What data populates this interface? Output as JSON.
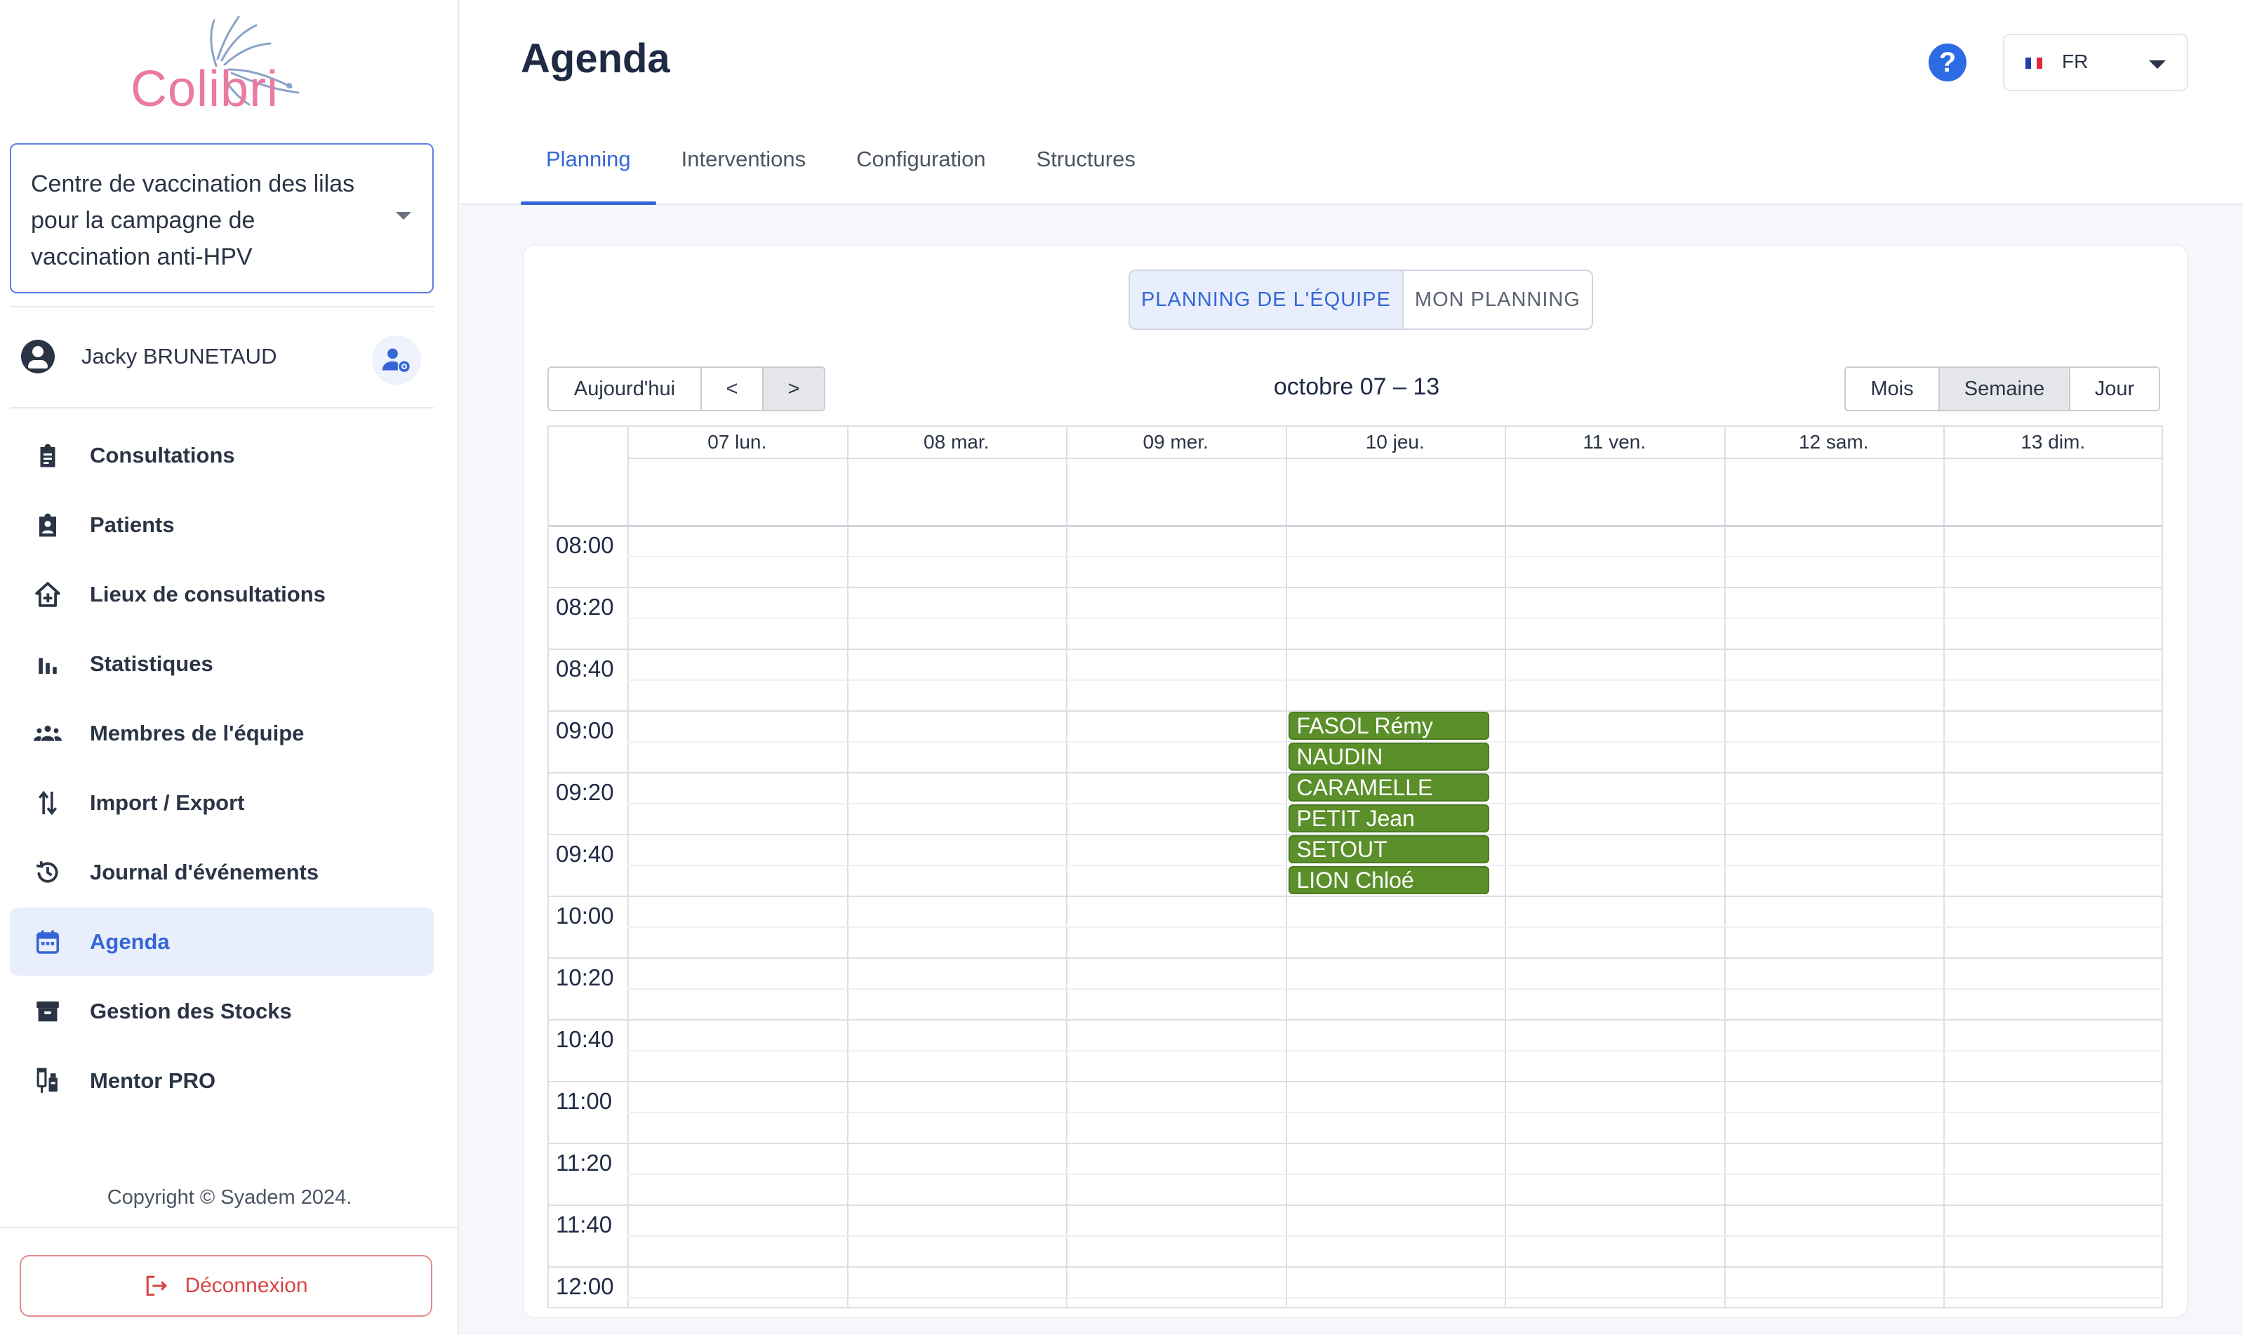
{
  "app": {
    "logo_text": "Colibri"
  },
  "sidebar": {
    "structure": "Centre de vaccination des lilas pour la campagne de vaccination anti-HPV",
    "user_name": "Jacky BRUNETAUD",
    "items": [
      {
        "label": "Consultations",
        "icon": "clipboard-icon",
        "active": false
      },
      {
        "label": "Patients",
        "icon": "patient-badge-icon",
        "active": false
      },
      {
        "label": "Lieux de consultations",
        "icon": "house-plus-icon",
        "active": false
      },
      {
        "label": "Statistiques",
        "icon": "bar-chart-icon",
        "active": false
      },
      {
        "label": "Membres de l'équipe",
        "icon": "team-icon",
        "active": false
      },
      {
        "label": "Import / Export",
        "icon": "import-export-icon",
        "active": false
      },
      {
        "label": "Journal d'événements",
        "icon": "history-icon",
        "active": false
      },
      {
        "label": "Agenda",
        "icon": "calendar-icon",
        "active": true
      },
      {
        "label": "Gestion des Stocks",
        "icon": "archive-box-icon",
        "active": false
      },
      {
        "label": "Mentor PRO",
        "icon": "vaccine-icon",
        "active": false
      }
    ],
    "copyright": "Copyright © Syadem 2024.",
    "logout_label": "Déconnexion"
  },
  "header": {
    "title": "Agenda",
    "help_label": "?",
    "language": "FR",
    "tabs": [
      {
        "label": "Planning",
        "active": true
      },
      {
        "label": "Interventions",
        "active": false
      },
      {
        "label": "Configuration",
        "active": false
      },
      {
        "label": "Structures",
        "active": false
      }
    ]
  },
  "calendar": {
    "view_toggle": {
      "team": "PLANNING DE L'ÉQUIPE",
      "mine": "MON PLANNING"
    },
    "nav": {
      "today": "Aujourd'hui",
      "prev": "<",
      "next": ">"
    },
    "range_title": "octobre 07 – 13",
    "views": {
      "month": "Mois",
      "week": "Semaine",
      "day": "Jour"
    },
    "days": [
      "07 lun.",
      "08 mar.",
      "09 mer.",
      "10 jeu.",
      "11 ven.",
      "12 sam.",
      "13 dim."
    ],
    "times": [
      "08:00",
      "08:20",
      "08:40",
      "09:00",
      "09:20",
      "09:40",
      "10:00",
      "10:20",
      "10:40",
      "11:00",
      "11:20",
      "11:40",
      "12:00"
    ],
    "events": [
      {
        "day": "10 jeu.",
        "start": "09:00",
        "name": "FASOL Rémy"
      },
      {
        "day": "10 jeu.",
        "start": "09:10",
        "name": "NAUDIN"
      },
      {
        "day": "10 jeu.",
        "start": "09:20",
        "name": "CARAMELLE"
      },
      {
        "day": "10 jeu.",
        "start": "09:30",
        "name": "PETIT Jean"
      },
      {
        "day": "10 jeu.",
        "start": "09:40",
        "name": "SETOUT"
      },
      {
        "day": "10 jeu.",
        "start": "09:50",
        "name": "LION Chloé"
      }
    ],
    "event_color": "#5a8f29"
  },
  "colors": {
    "accent": "#3466d6",
    "danger": "#d64545",
    "brand_pink": "#e97aa0"
  }
}
